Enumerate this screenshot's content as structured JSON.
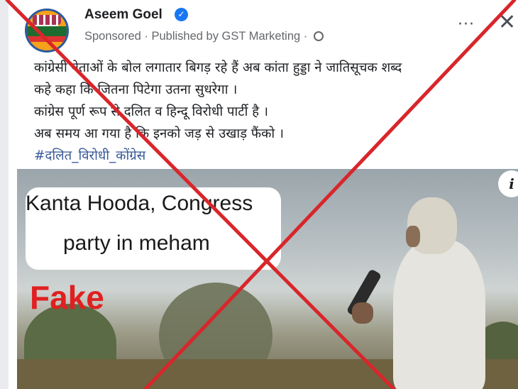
{
  "post": {
    "author": "Aseem Goel",
    "sponsored": "Sponsored",
    "published_by": " · Published by GST Marketing · ",
    "more_label": "···",
    "close_label": "✕",
    "lines": [
      "कांग्रेसी नेताओं के बोल लगातार बिगड़ रहे हैं अब कांता हुड्डा ने जातिसूचक शब्द",
      "कहे  कहा कि जितना पिटेगा उतना सुधरेगा ।",
      "कांग्रेस  पूर्ण रूप से दलित व हिन्दू विरोधी पार्टी है ।",
      "अब समय आ गया है कि इनको जड़ से उखाड़ फैंको ।"
    ],
    "hashtag": "#दलित_विरोधी_कोंग्रेस"
  },
  "media": {
    "caption_line1": "Kanta Hooda, Congress",
    "caption_line2": "party in meham",
    "stamp": "Fake",
    "info_label": "i"
  },
  "overlay": {
    "cross_color": "#d8262b"
  },
  "icons": [
    "verified-badge-icon",
    "globe-icon",
    "more-options-icon",
    "close-icon",
    "info-icon"
  ]
}
